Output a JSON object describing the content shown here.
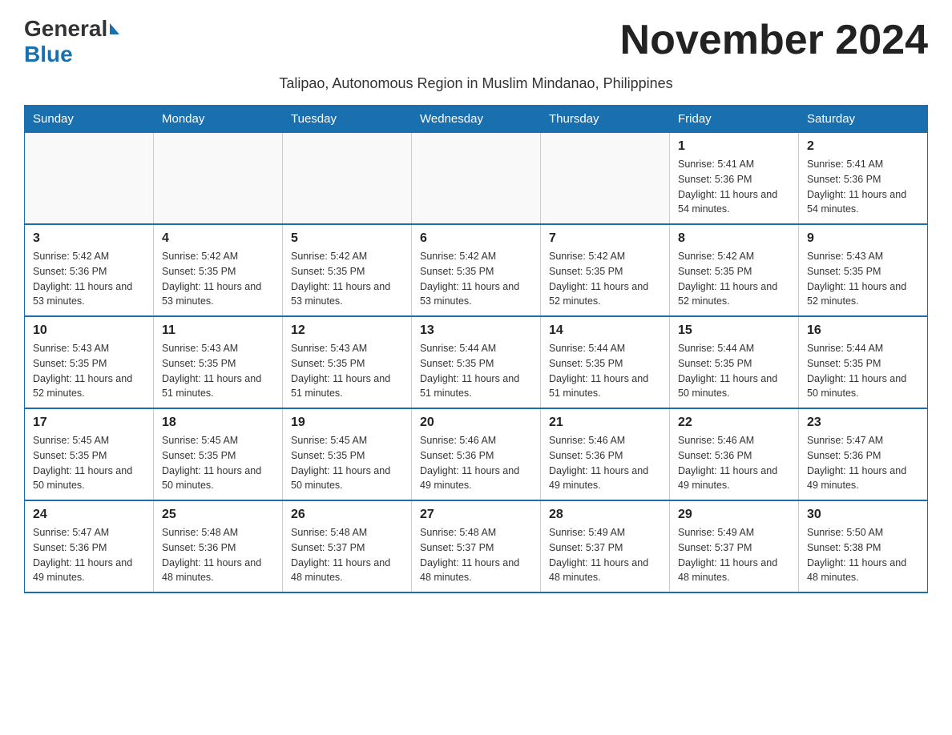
{
  "header": {
    "logo_general": "General",
    "logo_blue": "Blue",
    "title": "November 2024",
    "subtitle": "Talipao, Autonomous Region in Muslim Mindanao, Philippines"
  },
  "calendar": {
    "days_of_week": [
      "Sunday",
      "Monday",
      "Tuesday",
      "Wednesday",
      "Thursday",
      "Friday",
      "Saturday"
    ],
    "weeks": [
      [
        {
          "day": "",
          "info": ""
        },
        {
          "day": "",
          "info": ""
        },
        {
          "day": "",
          "info": ""
        },
        {
          "day": "",
          "info": ""
        },
        {
          "day": "",
          "info": ""
        },
        {
          "day": "1",
          "info": "Sunrise: 5:41 AM\nSunset: 5:36 PM\nDaylight: 11 hours and 54 minutes."
        },
        {
          "day": "2",
          "info": "Sunrise: 5:41 AM\nSunset: 5:36 PM\nDaylight: 11 hours and 54 minutes."
        }
      ],
      [
        {
          "day": "3",
          "info": "Sunrise: 5:42 AM\nSunset: 5:36 PM\nDaylight: 11 hours and 53 minutes."
        },
        {
          "day": "4",
          "info": "Sunrise: 5:42 AM\nSunset: 5:35 PM\nDaylight: 11 hours and 53 minutes."
        },
        {
          "day": "5",
          "info": "Sunrise: 5:42 AM\nSunset: 5:35 PM\nDaylight: 11 hours and 53 minutes."
        },
        {
          "day": "6",
          "info": "Sunrise: 5:42 AM\nSunset: 5:35 PM\nDaylight: 11 hours and 53 minutes."
        },
        {
          "day": "7",
          "info": "Sunrise: 5:42 AM\nSunset: 5:35 PM\nDaylight: 11 hours and 52 minutes."
        },
        {
          "day": "8",
          "info": "Sunrise: 5:42 AM\nSunset: 5:35 PM\nDaylight: 11 hours and 52 minutes."
        },
        {
          "day": "9",
          "info": "Sunrise: 5:43 AM\nSunset: 5:35 PM\nDaylight: 11 hours and 52 minutes."
        }
      ],
      [
        {
          "day": "10",
          "info": "Sunrise: 5:43 AM\nSunset: 5:35 PM\nDaylight: 11 hours and 52 minutes."
        },
        {
          "day": "11",
          "info": "Sunrise: 5:43 AM\nSunset: 5:35 PM\nDaylight: 11 hours and 51 minutes."
        },
        {
          "day": "12",
          "info": "Sunrise: 5:43 AM\nSunset: 5:35 PM\nDaylight: 11 hours and 51 minutes."
        },
        {
          "day": "13",
          "info": "Sunrise: 5:44 AM\nSunset: 5:35 PM\nDaylight: 11 hours and 51 minutes."
        },
        {
          "day": "14",
          "info": "Sunrise: 5:44 AM\nSunset: 5:35 PM\nDaylight: 11 hours and 51 minutes."
        },
        {
          "day": "15",
          "info": "Sunrise: 5:44 AM\nSunset: 5:35 PM\nDaylight: 11 hours and 50 minutes."
        },
        {
          "day": "16",
          "info": "Sunrise: 5:44 AM\nSunset: 5:35 PM\nDaylight: 11 hours and 50 minutes."
        }
      ],
      [
        {
          "day": "17",
          "info": "Sunrise: 5:45 AM\nSunset: 5:35 PM\nDaylight: 11 hours and 50 minutes."
        },
        {
          "day": "18",
          "info": "Sunrise: 5:45 AM\nSunset: 5:35 PM\nDaylight: 11 hours and 50 minutes."
        },
        {
          "day": "19",
          "info": "Sunrise: 5:45 AM\nSunset: 5:35 PM\nDaylight: 11 hours and 50 minutes."
        },
        {
          "day": "20",
          "info": "Sunrise: 5:46 AM\nSunset: 5:36 PM\nDaylight: 11 hours and 49 minutes."
        },
        {
          "day": "21",
          "info": "Sunrise: 5:46 AM\nSunset: 5:36 PM\nDaylight: 11 hours and 49 minutes."
        },
        {
          "day": "22",
          "info": "Sunrise: 5:46 AM\nSunset: 5:36 PM\nDaylight: 11 hours and 49 minutes."
        },
        {
          "day": "23",
          "info": "Sunrise: 5:47 AM\nSunset: 5:36 PM\nDaylight: 11 hours and 49 minutes."
        }
      ],
      [
        {
          "day": "24",
          "info": "Sunrise: 5:47 AM\nSunset: 5:36 PM\nDaylight: 11 hours and 49 minutes."
        },
        {
          "day": "25",
          "info": "Sunrise: 5:48 AM\nSunset: 5:36 PM\nDaylight: 11 hours and 48 minutes."
        },
        {
          "day": "26",
          "info": "Sunrise: 5:48 AM\nSunset: 5:37 PM\nDaylight: 11 hours and 48 minutes."
        },
        {
          "day": "27",
          "info": "Sunrise: 5:48 AM\nSunset: 5:37 PM\nDaylight: 11 hours and 48 minutes."
        },
        {
          "day": "28",
          "info": "Sunrise: 5:49 AM\nSunset: 5:37 PM\nDaylight: 11 hours and 48 minutes."
        },
        {
          "day": "29",
          "info": "Sunrise: 5:49 AM\nSunset: 5:37 PM\nDaylight: 11 hours and 48 minutes."
        },
        {
          "day": "30",
          "info": "Sunrise: 5:50 AM\nSunset: 5:38 PM\nDaylight: 11 hours and 48 minutes."
        }
      ]
    ]
  }
}
